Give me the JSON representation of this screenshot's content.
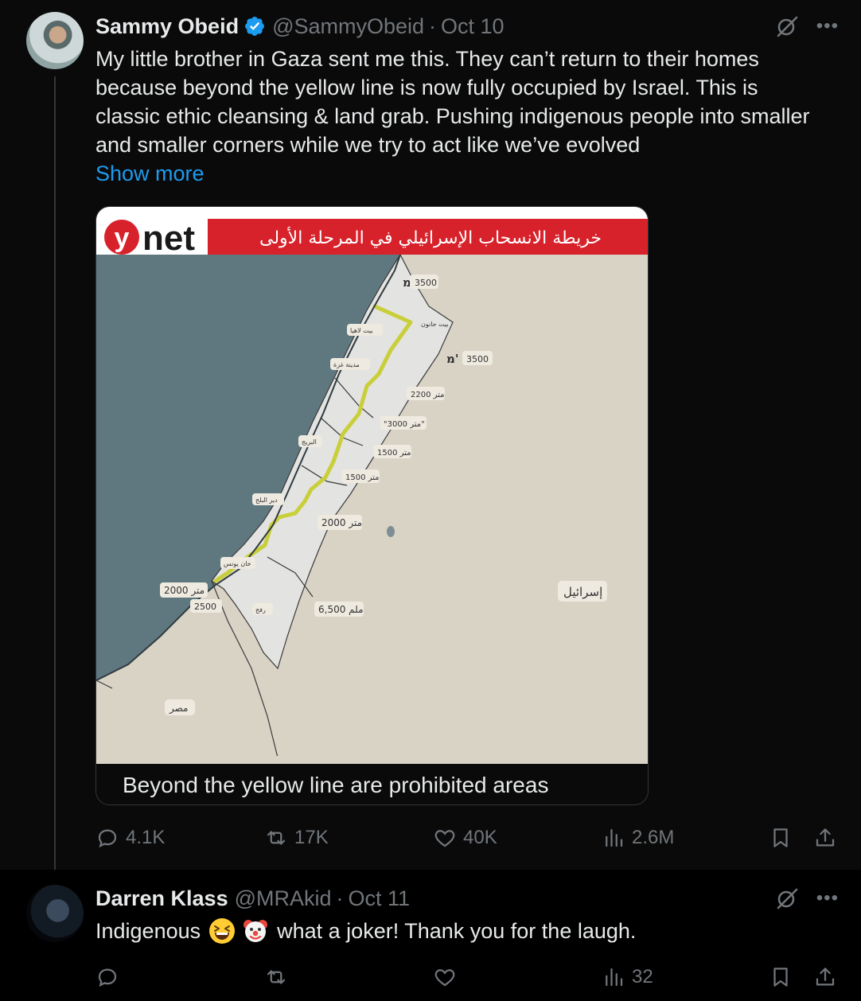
{
  "tweet": {
    "author_name": "Sammy Obeid",
    "handle": "@SammyObeid",
    "separator": "·",
    "date": "Oct 10",
    "text_lines": [
      "My little brother in Gaza sent me this. They can’t return to their homes",
      "because beyond the yellow line is now fully occupied by Israel. This is",
      "classic ethic cleansing & land grab. Pushing indigenous people into smaller",
      "and smaller corners while we try to act like we’ve evolved"
    ],
    "show_more": "Show more",
    "media_caption": "Beyond the yellow line are prohibited areas",
    "map": {
      "logo_letter": "y",
      "logo_text": "net",
      "banner_title": "خريطة الانسحاب الإسرائيلي في المرحلة الأولى",
      "labels": {
        "m3500_top": "3500",
        "m3500_right": "3500",
        "mem_top": "מ'",
        "mem_right": "מ'",
        "d2200": "2200 متر",
        "d3000": "\"3000 متر\"",
        "d1500a": "1500 متر",
        "d1500b": "1500 متر",
        "d2000": "2000 متر",
        "d2000_left": "2000 متر",
        "d2500": "2500",
        "d6500": "6,500 ملم",
        "israel": "إسرائيل",
        "egypt": "مصر",
        "beit_hanoun": "بيت حانون",
        "beit_lahia": "بيت لاهيا",
        "gaza_city": "مدينة غزة",
        "bureij": "البريج",
        "deir_balah": "دير البلح",
        "khan_younis": "خان يونس",
        "rafah": "رفح"
      }
    },
    "stats": {
      "replies": "4.1K",
      "reposts": "17K",
      "likes": "40K",
      "views": "2.6M"
    }
  },
  "reply": {
    "author_name": "Darren Klass",
    "handle": "@MRAkid",
    "separator": "·",
    "date": "Oct 11",
    "text_before": "Indigenous",
    "text_after": "what a joker! Thank you for the laugh.",
    "emojis": [
      "grinning-squinting-face",
      "clown-face"
    ],
    "stats": {
      "views": "32"
    }
  },
  "colors": {
    "link": "#1d9bf0",
    "muted": "#71767b",
    "verified": "#1d9bf0",
    "map_sea": "#5f7880",
    "map_land": "#d9d3c6",
    "gaza_strip": "#e3e3e1",
    "yellow_line": "#c9cf3a",
    "banner_red": "#d8222b"
  }
}
